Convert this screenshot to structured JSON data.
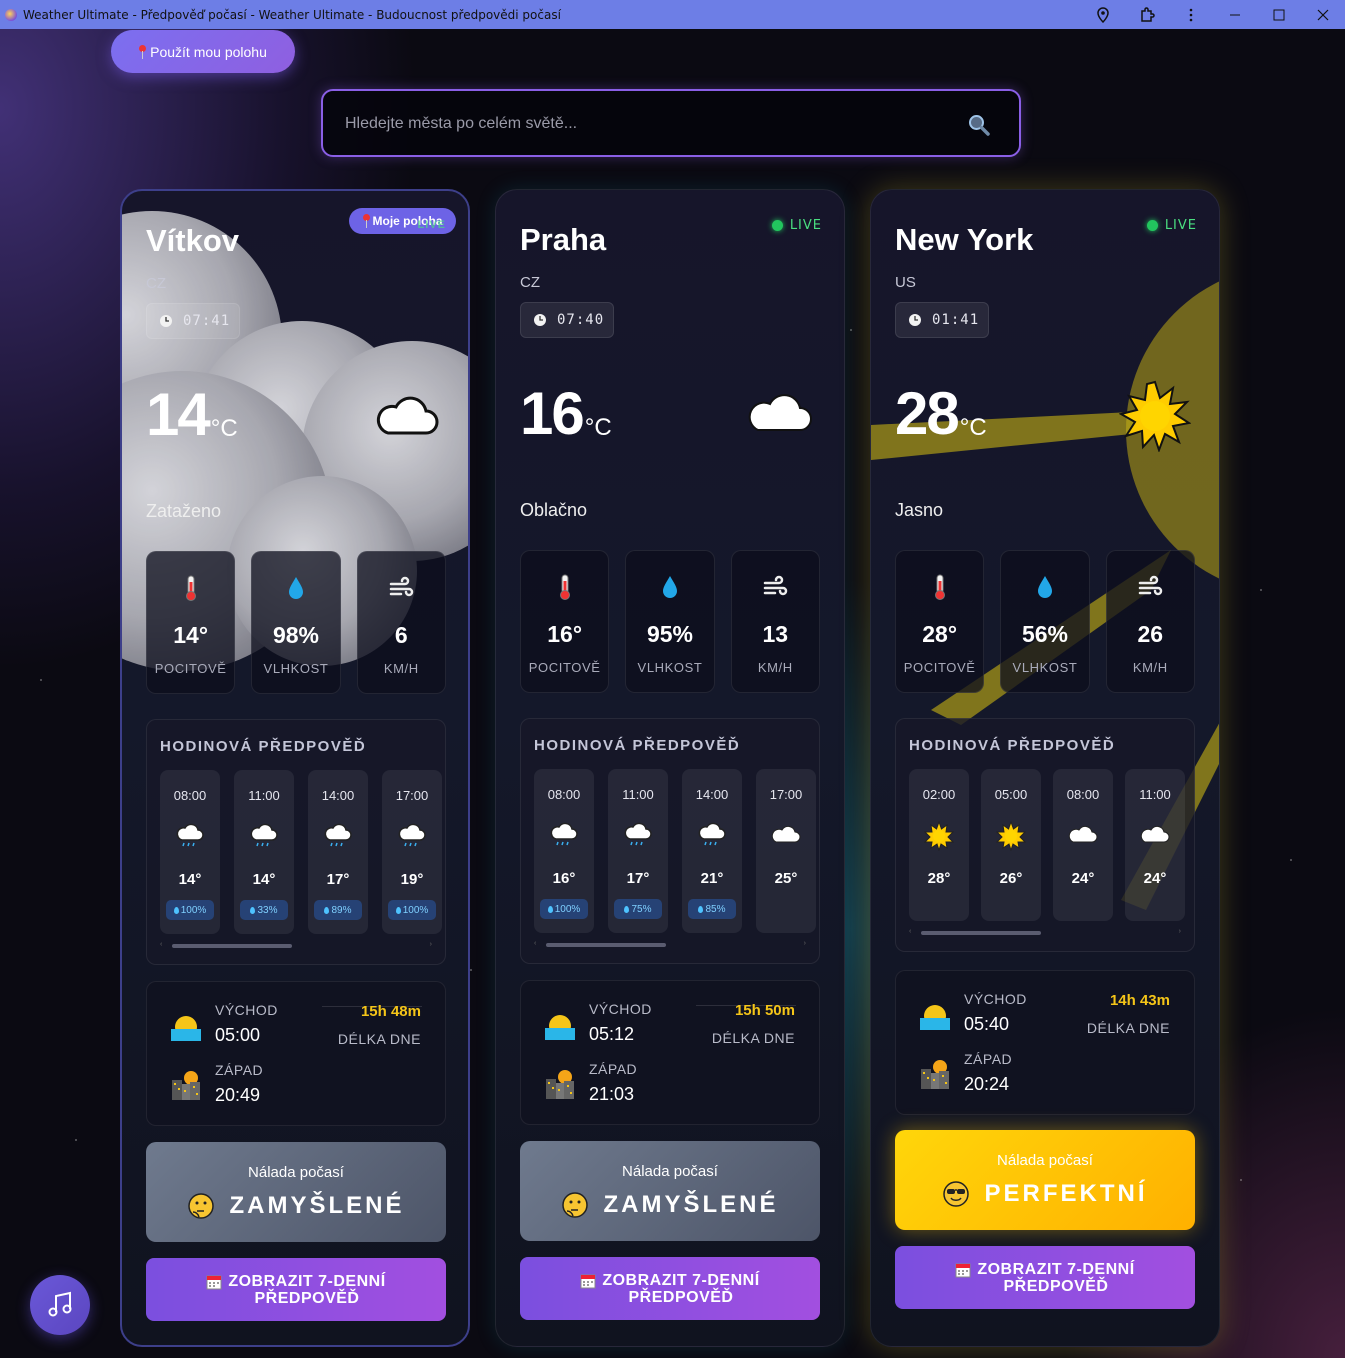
{
  "window": {
    "title": "Weather Ultimate - Předpověď počasí - Weather Ultimate - Budoucnost předpovědi počasí"
  },
  "header": {
    "locate_label": "Použít mou polohu",
    "search_placeholder": "Hledejte města po celém světě..."
  },
  "labels": {
    "feels": "POCITOVĚ",
    "humidity": "VLHKOST",
    "wind_unit": "KM/H",
    "hourly_title": "HODINOVÁ PŘEDPOVĚĎ",
    "sunrise": "VÝCHOD",
    "sunset": "ZÁPAD",
    "daylength": "DÉLKA DNE",
    "mood_title": "Nálada počasí",
    "forecast_btn_line1": "ZOBRAZIT 7-DENNÍ",
    "forecast_btn_line2": "PŘEDPOVĚĎ",
    "live": "LIVE",
    "temp_unit": "°C"
  },
  "cards": [
    {
      "city": "Vítkov",
      "country": "CZ",
      "time": "07:41",
      "badge": "Moje poloha",
      "badge_ghost": "LIVE",
      "temp": "14",
      "description": "Zataženo",
      "icon": "cloud-icon",
      "feels": "14°",
      "humidity": "98%",
      "wind": "6",
      "hourly": [
        {
          "time": "08:00",
          "icon": "rain-cloud-icon",
          "temp": "14°",
          "rain": "100%"
        },
        {
          "time": "11:00",
          "icon": "rain-cloud-icon",
          "temp": "14°",
          "rain": "33%"
        },
        {
          "time": "14:00",
          "icon": "rain-cloud-icon",
          "temp": "17°",
          "rain": "89%"
        },
        {
          "time": "17:00",
          "icon": "rain-cloud-icon",
          "temp": "19°",
          "rain": "100%"
        }
      ],
      "sunrise": "05:00",
      "sunset": "20:49",
      "daylength": "15h 48m",
      "mood": "ZAMYŠLENÉ",
      "mood_emoji": "thinking-face-icon"
    },
    {
      "city": "Praha",
      "country": "CZ",
      "time": "07:40",
      "temp": "16",
      "description": "Oblačno",
      "icon": "cloud-icon",
      "feels": "16°",
      "humidity": "95%",
      "wind": "13",
      "hourly": [
        {
          "time": "08:00",
          "icon": "rain-cloud-icon",
          "temp": "16°",
          "rain": "100%"
        },
        {
          "time": "11:00",
          "icon": "rain-cloud-icon",
          "temp": "17°",
          "rain": "75%"
        },
        {
          "time": "14:00",
          "icon": "rain-cloud-icon",
          "temp": "21°",
          "rain": "85%"
        },
        {
          "time": "17:00",
          "icon": "cloud-icon",
          "temp": "25°",
          "rain": ""
        }
      ],
      "sunrise": "05:12",
      "sunset": "21:03",
      "daylength": "15h 50m",
      "mood": "ZAMYŠLENÉ",
      "mood_emoji": "thinking-face-icon"
    },
    {
      "city": "New York",
      "country": "US",
      "time": "01:41",
      "temp": "28",
      "description": "Jasno",
      "icon": "sun-icon",
      "feels": "28°",
      "humidity": "56%",
      "wind": "26",
      "hourly": [
        {
          "time": "02:00",
          "icon": "sun-icon",
          "temp": "28°",
          "rain": ""
        },
        {
          "time": "05:00",
          "icon": "sun-icon",
          "temp": "26°",
          "rain": ""
        },
        {
          "time": "08:00",
          "icon": "cloud-icon",
          "temp": "24°",
          "rain": ""
        },
        {
          "time": "11:00",
          "icon": "cloud-icon",
          "temp": "24°",
          "rain": ""
        }
      ],
      "sunrise": "05:40",
      "sunset": "20:24",
      "daylength": "14h 43m",
      "mood": "PERFEKTNÍ",
      "mood_emoji": "sunglasses-face-icon"
    }
  ],
  "colors": {
    "accent": "#7b4fdf",
    "live": "#22c55e",
    "daylength": "#f5c518",
    "perfect_mood": "#ffc800"
  }
}
